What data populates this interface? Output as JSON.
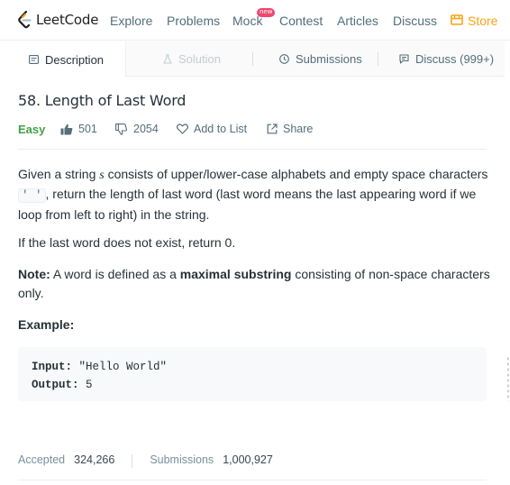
{
  "nav": {
    "logo": "LeetCode",
    "items": [
      "Explore",
      "Problems",
      "Mock",
      "Contest",
      "Articles",
      "Discuss"
    ],
    "new_badge": "new",
    "store": "Store"
  },
  "tabs": {
    "description": "Description",
    "solution": "Solution",
    "submissions": "Submissions",
    "discuss": "Discuss (999+)"
  },
  "problem": {
    "title": "58. Length of Last Word",
    "difficulty": "Easy",
    "likes": "501",
    "dislikes": "2054",
    "add_to_list": "Add to List",
    "share": "Share"
  },
  "description": {
    "p1_a": "Given a string ",
    "p1_var": "s",
    "p1_b": " consists of upper/lower-case alphabets and empty space characters",
    "p1_code": "' '",
    "p1_c": ", return the length of last word (last word means the last appearing word if we loop from left to right) in the string.",
    "p2": "If the last word does not exist, return 0.",
    "p3_label": "Note:",
    "p3_a": " A word is defined as a ",
    "p3_bold": "maximal substring",
    "p3_b": " consisting of non-space characters only.",
    "example_label": "Example:",
    "input_label": "Input:",
    "input_value": " \"Hello World\"",
    "output_label": "Output:",
    "output_value": " 5"
  },
  "stats": {
    "accepted_label": "Accepted",
    "accepted_value": "324,266",
    "submissions_label": "Submissions",
    "submissions_value": "1,000,927"
  },
  "colors": {
    "accent": "#ffa116",
    "easy": "#43a047",
    "new_badge": "#ef476f"
  }
}
